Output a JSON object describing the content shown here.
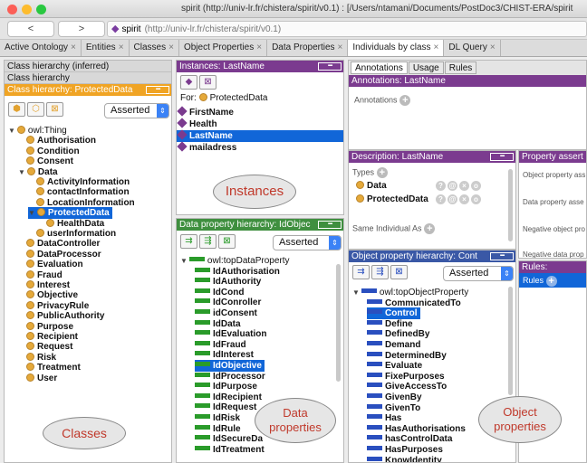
{
  "window": {
    "title": "spirit (http://univ-lr.fr/chistera/spirit/v0.1) : [/Users/ntamani/Documents/PostDoc3/CHIST-ERA/spirit"
  },
  "toolbar": {
    "back_label": "<",
    "forward_label": ">",
    "ontology_name": "spirit",
    "ontology_iri": "(http://univ-lr.fr/chistera/spirit/v0.1)"
  },
  "tabs": [
    {
      "label": "Active Ontology"
    },
    {
      "label": "Entities"
    },
    {
      "label": "Classes"
    },
    {
      "label": "Object Properties"
    },
    {
      "label": "Data Properties"
    },
    {
      "label": "Individuals by class"
    },
    {
      "label": "DL Query"
    }
  ],
  "tab_close": "×",
  "class_panel": {
    "header": "Class hierarchy (inferred)",
    "subheader": "Class hierarchy",
    "title": "Class hierarchy: ProtectedData",
    "mode": "Asserted",
    "items": [
      {
        "label": "owl:Thing"
      },
      {
        "label": "Authorisation"
      },
      {
        "label": "Condition"
      },
      {
        "label": "Consent"
      },
      {
        "label": "Data"
      },
      {
        "label": "ActivityInformation"
      },
      {
        "label": "contactInformation"
      },
      {
        "label": "LocationInformation"
      },
      {
        "label": "ProtectedData"
      },
      {
        "label": "HealthData"
      },
      {
        "label": "userInformation"
      },
      {
        "label": "DataController"
      },
      {
        "label": "DataProcessor"
      },
      {
        "label": "Evaluation"
      },
      {
        "label": "Fraud"
      },
      {
        "label": "Interest"
      },
      {
        "label": "Objective"
      },
      {
        "label": "PrivacyRule"
      },
      {
        "label": "PublicAuthority"
      },
      {
        "label": "Purpose"
      },
      {
        "label": "Recipient"
      },
      {
        "label": "Request"
      },
      {
        "label": "Risk"
      },
      {
        "label": "Treatment"
      },
      {
        "label": "User"
      }
    ],
    "callout": "Classes"
  },
  "instances_panel": {
    "title": "Instances: LastName",
    "for_label": "For:",
    "for_class": "ProtectedData",
    "items": [
      {
        "label": "FirstName"
      },
      {
        "label": "Health"
      },
      {
        "label": "LastName"
      },
      {
        "label": "mailadress"
      }
    ],
    "callout": "Instances"
  },
  "data_prop_panel": {
    "title": "Data property hierarchy: IdObjec",
    "mode": "Asserted",
    "items": [
      {
        "label": "owl:topDataProperty"
      },
      {
        "label": "IdAuthorisation"
      },
      {
        "label": "IdAuthority"
      },
      {
        "label": "IdCond"
      },
      {
        "label": "IdConroller"
      },
      {
        "label": "idConsent"
      },
      {
        "label": "IdData"
      },
      {
        "label": "IdEvaluation"
      },
      {
        "label": "IdFraud"
      },
      {
        "label": "IdInterest"
      },
      {
        "label": "IdObjective"
      },
      {
        "label": "IdProcessor"
      },
      {
        "label": "IdPurpose"
      },
      {
        "label": "IdRecipient"
      },
      {
        "label": "IdRequest"
      },
      {
        "label": "IdRisk"
      },
      {
        "label": "IdRule"
      },
      {
        "label": "IdSecureDa"
      },
      {
        "label": "IdTreatment"
      }
    ],
    "callout_line1": "Data",
    "callout_line2": "properties"
  },
  "annotations_panel": {
    "tabs": [
      {
        "label": "Annotations"
      },
      {
        "label": "Usage"
      },
      {
        "label": "Rules"
      }
    ],
    "title": "Annotations: LastName",
    "annotations_label": "Annotations"
  },
  "description_panel": {
    "title": "Description: LastName",
    "types_label": "Types",
    "types": [
      {
        "label": "Data"
      },
      {
        "label": "ProtectedData"
      }
    ],
    "same_individual_label": "Same Individual As"
  },
  "property_assertions_panel": {
    "title": "Property assert",
    "rows": [
      {
        "label": "Object property ass"
      },
      {
        "label": "Data property asse"
      },
      {
        "label": "Negative object pro"
      },
      {
        "label": "Negative data prop"
      }
    ]
  },
  "object_prop_panel": {
    "title": "Object property hierarchy: Cont",
    "mode": "Asserted",
    "items": [
      {
        "label": "owl:topObjectProperty"
      },
      {
        "label": "CommunicatedTo"
      },
      {
        "label": "Control"
      },
      {
        "label": "Define"
      },
      {
        "label": "DefinedBy"
      },
      {
        "label": "Demand"
      },
      {
        "label": "DeterminedBy"
      },
      {
        "label": "Evaluate"
      },
      {
        "label": "FixePurposes"
      },
      {
        "label": "GiveAccessTo"
      },
      {
        "label": "GivenBy"
      },
      {
        "label": "GivenTo"
      },
      {
        "label": "Has"
      },
      {
        "label": "HasAuthorisations"
      },
      {
        "label": "hasControlData"
      },
      {
        "label": "HasPurposes"
      },
      {
        "label": "KnowIdentity"
      }
    ],
    "callout_line1": "Object",
    "callout_line2": "properties"
  },
  "rules_panel": {
    "title": "Rules:",
    "row_label": "Rules"
  },
  "colors": {
    "class_header": "#f0a424",
    "instance_header": "#7b3b8f",
    "data_header": "#3f8f3f",
    "object_header": "#3a58a6",
    "selection": "#1166d8"
  }
}
